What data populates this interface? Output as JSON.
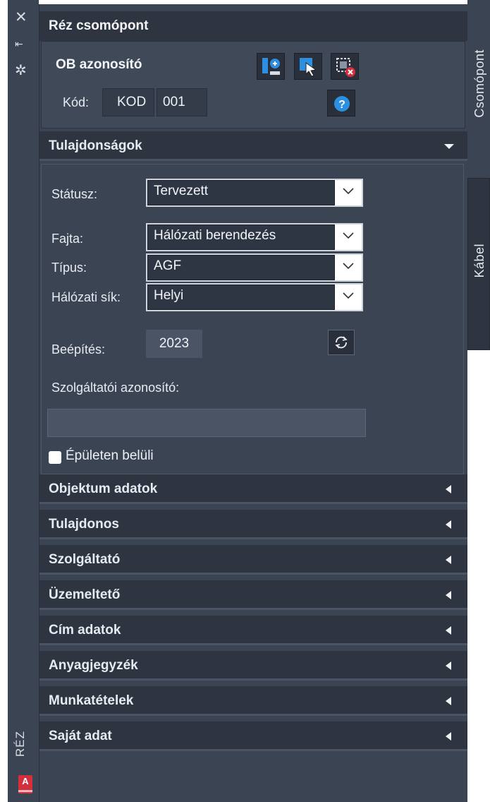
{
  "strip": {
    "title": "RÉZ",
    "close_icon": "close-icon",
    "pin_icon": "pin-icon",
    "settings_icon": "settings-icon",
    "app_icon": "A"
  },
  "panel": {
    "title": "Réz csomópont",
    "ob_label": "OB azonosító",
    "kod_label": "Kód:",
    "kod_prefix": "KOD",
    "kod_number": "001",
    "toolbar": [
      "add-node-icon",
      "select-cursor-icon",
      "delete-node-icon",
      "help-icon"
    ]
  },
  "properties": {
    "header": "Tulajdonságok",
    "status_label": "Státusz:",
    "status_value": "Tervezett",
    "fajta_label": "Fajta:",
    "fajta_value": "Hálózati berendezés",
    "tipus_label": "Típus:",
    "tipus_value": "AGF",
    "halozati_label": "Hálózati sík:",
    "halozati_value": "Helyi",
    "beepites_label": "Beépítés:",
    "beepites_value": "2023",
    "szolg_label": "Szolgáltatói azonosító:",
    "szolg_value": "",
    "epuleten_label": "Épületen belüli",
    "epuleten_checked": false
  },
  "sections": [
    "Objektum adatok",
    "Tulajdonos",
    "Szolgáltató",
    "Üzemeltető",
    "Cím adatok",
    "Anyagjegyzék",
    "Munkatételek",
    "Saját adat"
  ],
  "side_tabs": [
    "Csomópont",
    "Kábel"
  ],
  "colors": {
    "panel_bg": "#3b4453",
    "header_bg": "#2e3440",
    "input_bg": "#4a5464",
    "accent_blue": "#2d8fe0",
    "accent_red": "#d42f3c"
  }
}
